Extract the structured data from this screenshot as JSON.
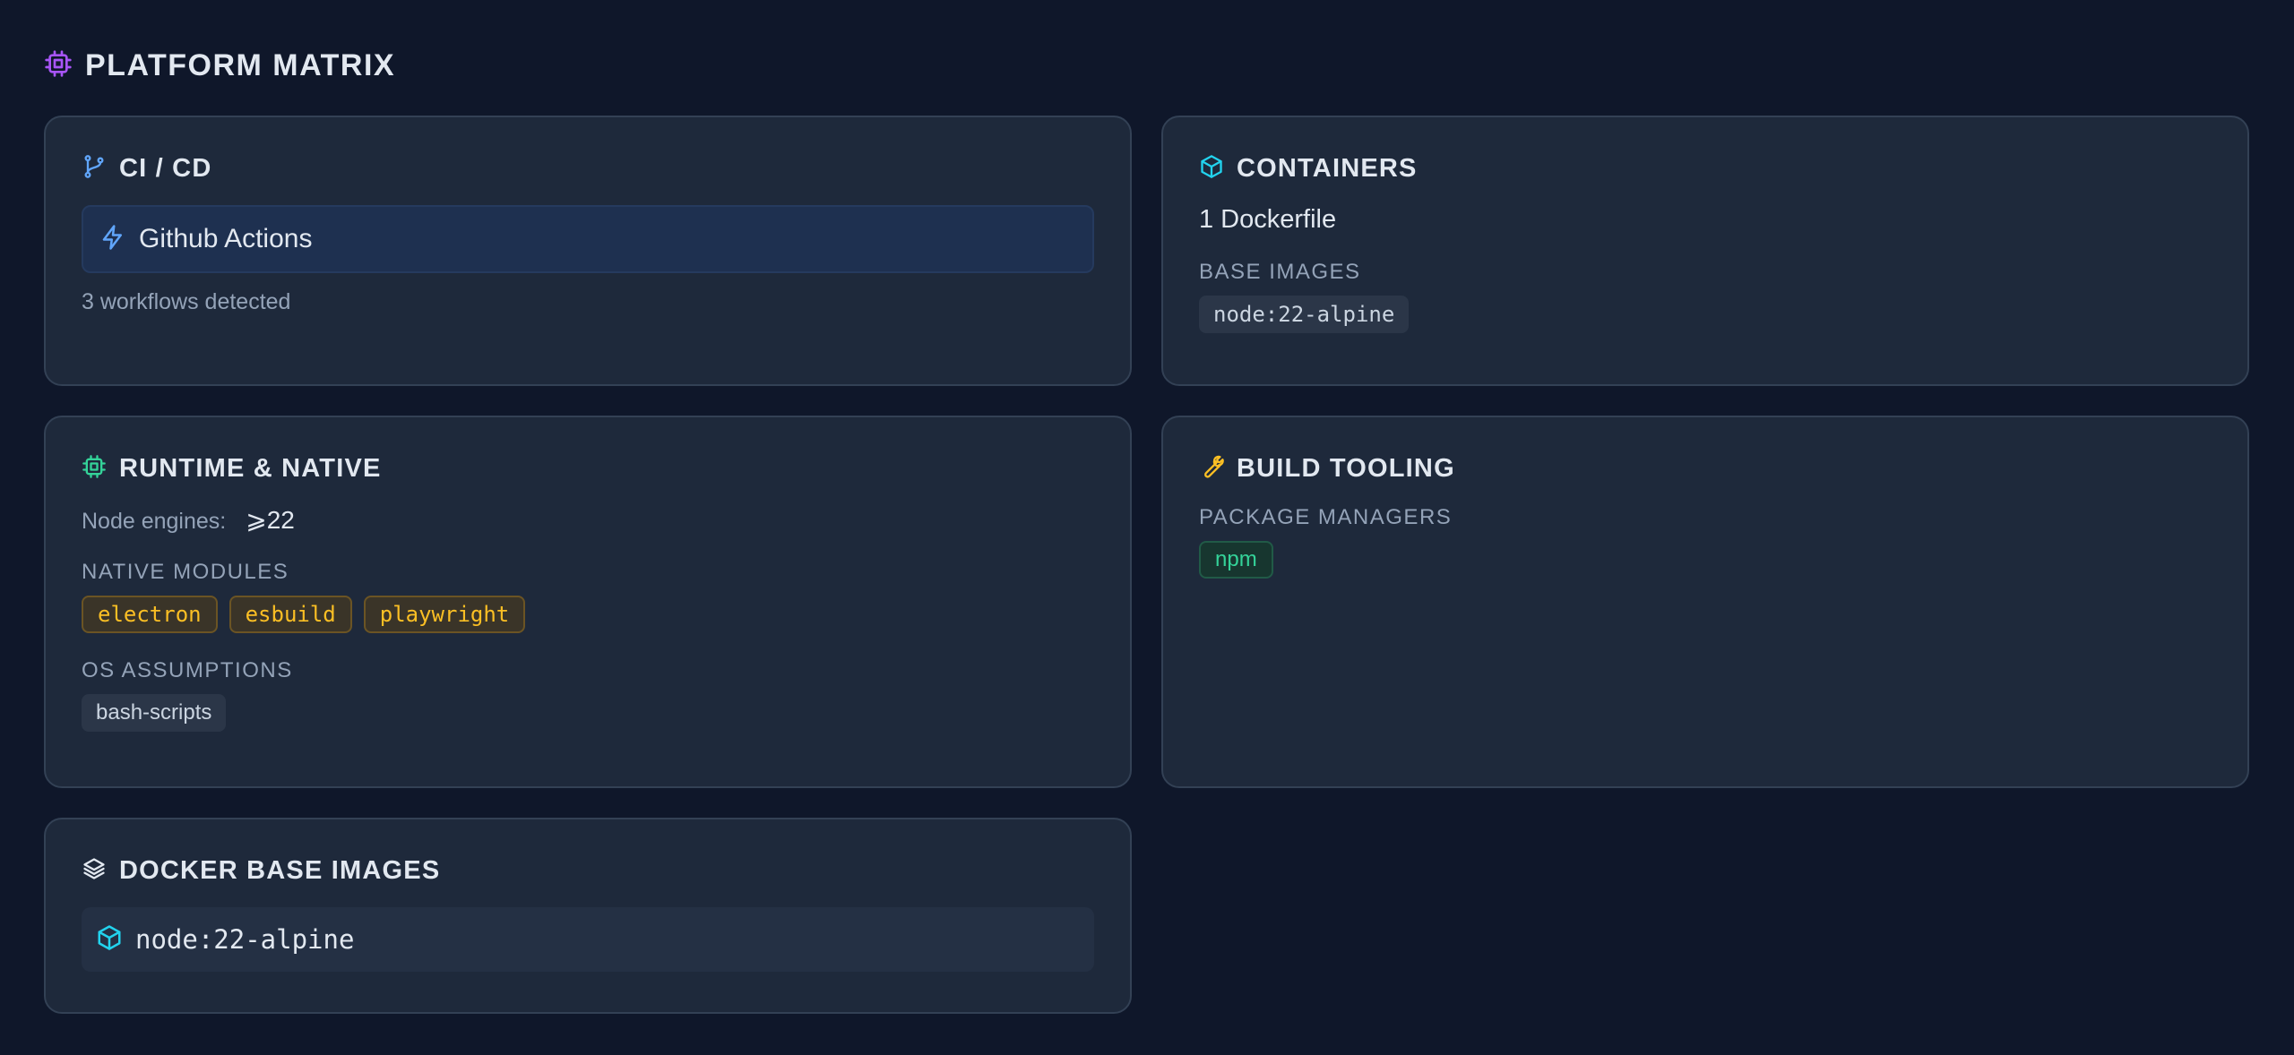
{
  "page": {
    "title": "PLATFORM MATRIX"
  },
  "colors": {
    "background": "#0f172a",
    "card": "#1e293b",
    "accent_purple": "#a855f7",
    "accent_blue": "#60a5fa",
    "accent_cyan": "#22d3ee",
    "accent_green": "#34d399",
    "accent_amber": "#fbbf24"
  },
  "ci": {
    "title": "CI / CD",
    "provider": "Github Actions",
    "summary": "3 workflows detected",
    "icon": "git-branch-icon",
    "provider_icon": "lightning-icon"
  },
  "containers": {
    "title": "CONTAINERS",
    "summary": "1 Dockerfile",
    "base_images_label": "BASE IMAGES",
    "base_images": [
      "node:22-alpine"
    ],
    "icon": "box-icon"
  },
  "runtime": {
    "title": "RUNTIME & NATIVE",
    "engines_label": "Node engines:",
    "engines_value": "⩾22",
    "native_modules_label": "NATIVE MODULES",
    "native_modules": [
      "electron",
      "esbuild",
      "playwright"
    ],
    "os_label": "OS ASSUMPTIONS",
    "os_assumptions": [
      "bash-scripts"
    ],
    "icon": "cpu-icon"
  },
  "build": {
    "title": "BUILD TOOLING",
    "package_managers_label": "PACKAGE MANAGERS",
    "package_managers": [
      "npm"
    ],
    "icon": "wrench-icon"
  },
  "docker": {
    "title": "DOCKER BASE IMAGES",
    "images": [
      "node:22-alpine"
    ],
    "icon": "layers-icon",
    "image_icon": "box-icon"
  }
}
